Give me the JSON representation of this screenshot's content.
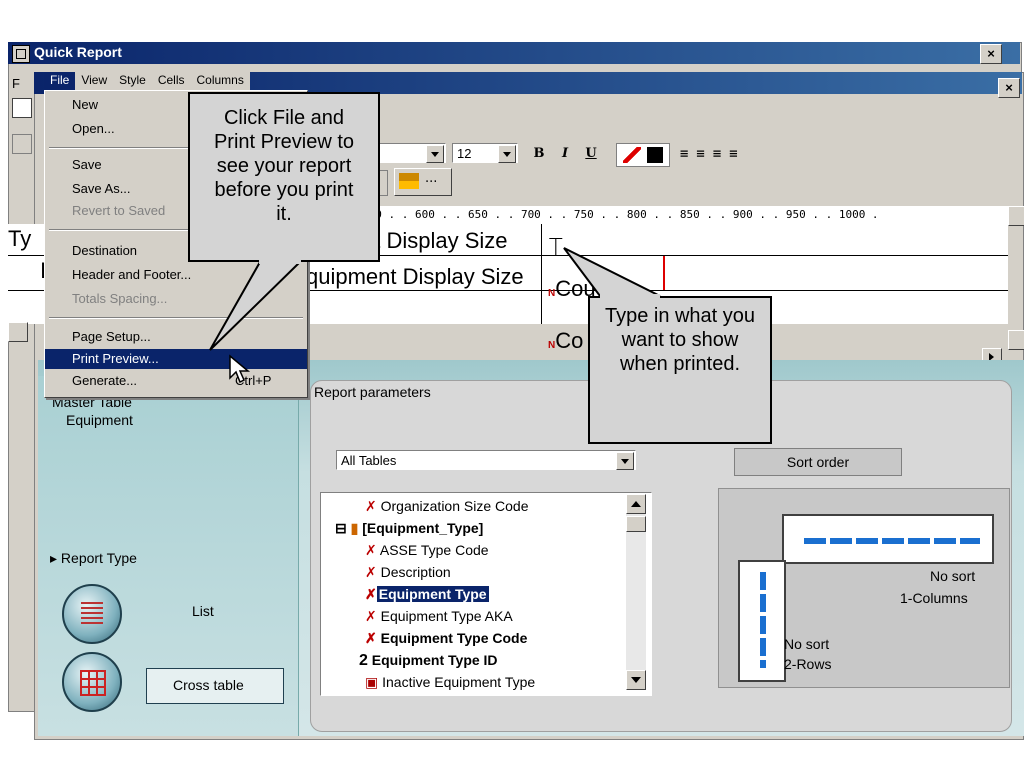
{
  "outer_window": {
    "title": "Quick Report",
    "close": "×",
    "menu_partial": "F"
  },
  "menubar": {
    "items": [
      "File",
      "View",
      "Style",
      "Cells",
      "Columns"
    ]
  },
  "inner_window": {
    "close": "×"
  },
  "file_menu": {
    "items": [
      {
        "label": "New",
        "disabled": false
      },
      {
        "label": "Open...",
        "disabled": false
      },
      {
        "label": "Save",
        "disabled": false
      },
      {
        "label": "Save As...",
        "disabled": false
      },
      {
        "label": "Revert to Saved",
        "disabled": true
      },
      {
        "label": "Destination",
        "disabled": false
      },
      {
        "label": "Header and Footer...",
        "disabled": false
      },
      {
        "label": "Totals Spacing...",
        "disabled": true
      },
      {
        "label": "Page Setup...",
        "disabled": false
      },
      {
        "label": "Print Preview...",
        "disabled": false,
        "selected": true
      },
      {
        "label": "Generate...",
        "disabled": false,
        "shortcut": "Ctrl+P"
      }
    ]
  },
  "toolbar": {
    "font_size": "12",
    "bold": "B",
    "italic": "I",
    "underline": "U",
    "ellipsis": "..."
  },
  "ruler": {
    "text": "550 . . 600 . . 650 . . 700 . . 750 . . 800 . . 850 . . 900 . . 950 . . 1000 ."
  },
  "grid": {
    "row1_left": "Ty",
    "row2_left": "I",
    "row1_text": "nt Display Size",
    "row2_text": "quipment Display Size",
    "col_cell_1": "Cou",
    "col_cell_2": "Co"
  },
  "callouts": {
    "print_preview": "Click File and Print Preview to see your report before you print it.",
    "type_in": "Type in what you want to show when printed."
  },
  "left_panel": {
    "master_table_label": "Master Table",
    "master_table_value": "Equipment",
    "report_type_label": "Report Type",
    "list_label": "List",
    "cross_table_label": "Cross table"
  },
  "right_panel": {
    "tab_label": "Report parameters",
    "table_filter": "All Tables",
    "tree_items": [
      {
        "label": "Organization Size Code",
        "bold": false,
        "icon": "field-icon"
      },
      {
        "label": "[Equipment_Type]",
        "bold": true,
        "icon": "table-icon"
      },
      {
        "label": "ASSE Type Code",
        "bold": false,
        "icon": "field-icon"
      },
      {
        "label": "Description",
        "bold": false,
        "icon": "field-icon"
      },
      {
        "label": "Equipment Type",
        "bold": true,
        "icon": "field-icon",
        "selected": true
      },
      {
        "label": "Equipment Type AKA",
        "bold": false,
        "icon": "field-icon"
      },
      {
        "label": "Equipment Type Code",
        "bold": true,
        "icon": "field-icon"
      },
      {
        "label": "Equipment Type ID",
        "bold": true,
        "icon": "numeric-icon"
      },
      {
        "label": "Inactive Equipment Type",
        "bold": false,
        "icon": "boolean-icon"
      }
    ],
    "sort_order_label": "Sort order",
    "columns_sort": "No sort",
    "columns_label": "1-Columns",
    "rows_sort": "No sort",
    "rows_label": "2-Rows"
  }
}
